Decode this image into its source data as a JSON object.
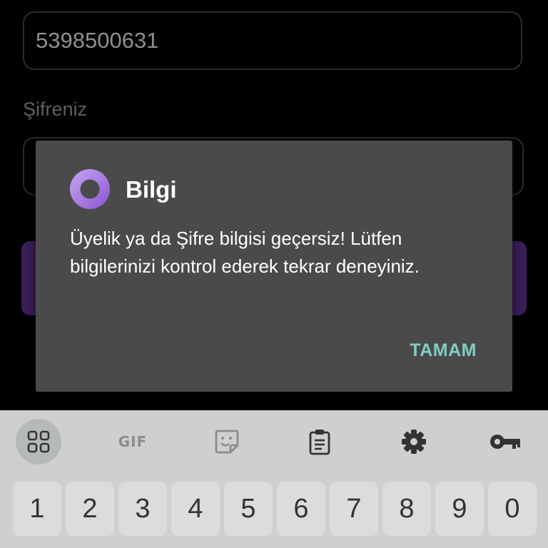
{
  "login": {
    "phone_value": "5398500631",
    "password_label": "Şifreniz"
  },
  "dialog": {
    "title": "Bilgi",
    "message": "Üyelik ya da Şifre bilgisi geçersiz! Lütfen bilgilerinizi kontrol ederek tekrar deneyiniz.",
    "ok_label": "TAMAM",
    "icon": "app-ring-icon",
    "accent_color": "#7fcfc1"
  },
  "keyboard": {
    "toolbar": {
      "apps_icon": "apps-grid-icon",
      "gif_label": "GIF",
      "sticker_icon": "sticker-icon",
      "clipboard_icon": "clipboard-icon",
      "settings_icon": "gear-icon",
      "password_icon": "key-icon"
    },
    "number_keys": [
      "1",
      "2",
      "3",
      "4",
      "5",
      "6",
      "7",
      "8",
      "9",
      "0"
    ]
  }
}
